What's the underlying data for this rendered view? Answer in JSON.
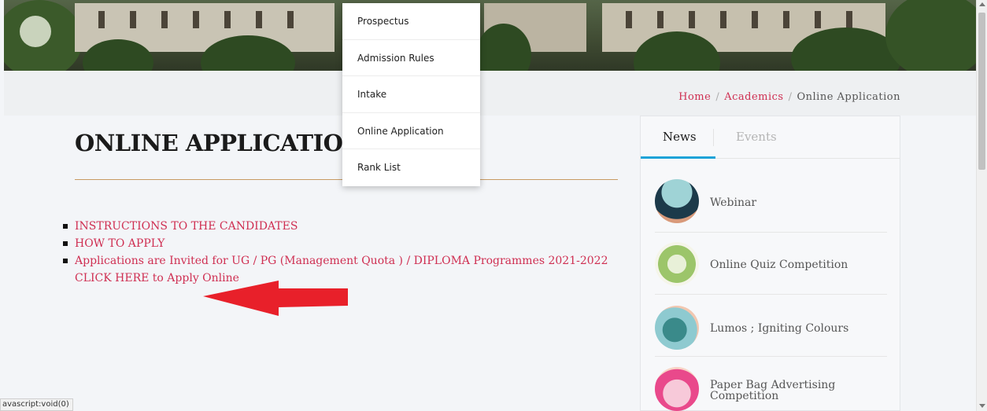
{
  "dropdown": {
    "items": [
      {
        "label": "Prospectus"
      },
      {
        "label": "Admission Rules"
      },
      {
        "label": "Intake"
      },
      {
        "label": "Online Application"
      },
      {
        "label": "Rank List"
      }
    ]
  },
  "breadcrumb": {
    "home": "Home",
    "academics": "Academics",
    "current": "Online Application",
    "separator": "/"
  },
  "main": {
    "title": "ONLINE APPLICATION",
    "links": [
      {
        "text": "INSTRUCTIONS TO THE CANDIDATES"
      },
      {
        "text": "HOW TO APPLY"
      },
      {
        "text": "Applications are Invited for UG / PG (Management Quota ) / DIPLOMA Programmes 2021-2022 CLICK HERE to Apply Online"
      }
    ]
  },
  "sidebar": {
    "tabs": [
      {
        "label": "News",
        "active": true
      },
      {
        "label": "Events",
        "active": false
      }
    ],
    "news": [
      {
        "title": "Webinar"
      },
      {
        "title": "Online Quiz Competition"
      },
      {
        "title": "Lumos ; Igniting Colours"
      },
      {
        "title": "Paper Bag Advertising Competition"
      }
    ]
  },
  "status": {
    "text": "avascript:void(0)"
  },
  "colors": {
    "link": "#cf2f52",
    "tab_indicator": "#1ea3d8",
    "arrow": "#e8202a",
    "title_rule": "#c89a62"
  }
}
